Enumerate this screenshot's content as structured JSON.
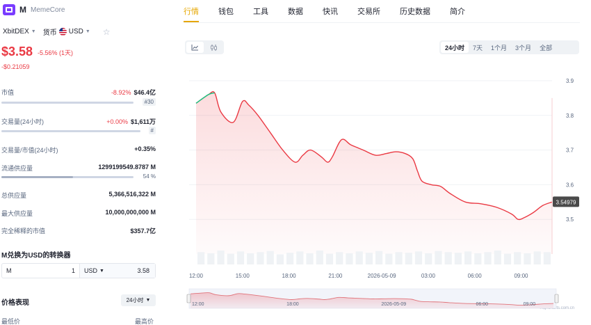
{
  "coin": {
    "symbol": "M",
    "name": "MemeCore"
  },
  "selectors": {
    "exchange": "XbitDEX",
    "currency_label": "货币",
    "currency": "USD"
  },
  "price": {
    "value": "$3.58",
    "change_pct": "-5.56% (1天)",
    "change_abs": "-$0.21059"
  },
  "stats": {
    "market_cap": {
      "label": "市值",
      "change": "-8.92%",
      "value": "$46.4亿",
      "rank": "#30"
    },
    "volume": {
      "label": "交易量(24小时)",
      "change": "+0.00%",
      "value": "$1,611万",
      "rank": "#"
    },
    "vol_mcap": {
      "label": "交易量/市值(24小时)",
      "value": "+0.35%"
    },
    "circ_supply": {
      "label": "流通供应量",
      "value": "1299199549.8787 M",
      "pct": "54 %",
      "fill": 0.54
    },
    "total_supply": {
      "label": "总供应量",
      "value": "5,366,516,322 M"
    },
    "max_supply": {
      "label": "最大供应量",
      "value": "10,000,000,000 M"
    },
    "fdv": {
      "label": "完全稀释的市值",
      "value": "$357.7亿"
    }
  },
  "converter": {
    "title": "M兑换为USD的转换器",
    "from_symbol": "M",
    "from_amount": "1",
    "to_symbol": "USD",
    "to_amount": "3.58"
  },
  "performance": {
    "title": "价格表现",
    "period": "24小时",
    "low_label": "最低价",
    "high_label": "最高价"
  },
  "tabs": [
    "行情",
    "钱包",
    "工具",
    "数据",
    "快讯",
    "交易所",
    "历史数据",
    "简介"
  ],
  "ranges": [
    "24小时",
    "7天",
    "1个月",
    "3个月",
    "全部"
  ],
  "icons": {
    "line_chart": "line-chart-icon",
    "candle_chart": "candlestick-icon",
    "star": "star-icon",
    "caret": "caret-down-icon"
  },
  "colors": {
    "down": "#ea3943",
    "up": "#16c784",
    "accent": "#e6a700"
  },
  "chart_data": {
    "type": "area",
    "x_ticks": [
      "12:00",
      "15:00",
      "18:00",
      "21:00",
      "2026-05-09",
      "03:00",
      "06:00",
      "09:00"
    ],
    "x_tick_hours": [
      0,
      3,
      6,
      9,
      12,
      15,
      18,
      21
    ],
    "y_ticks": [
      "3.9",
      "3.8",
      "3.7",
      "3.6",
      "3.5"
    ],
    "y_tick_values": [
      3.9,
      3.8,
      3.7,
      3.6,
      3.5
    ],
    "ylim": [
      3.4,
      3.9
    ],
    "xlim_hours": [
      0,
      23
    ],
    "current_price_label": "3.54979",
    "current_price": 3.54979,
    "hours": [
      0,
      0.8,
      1.2,
      1.6,
      2.4,
      3.0,
      3.4,
      4.0,
      4.8,
      5.6,
      6.4,
      6.9,
      7.4,
      8.1,
      8.5,
      8.8,
      9.4,
      10.0,
      10.8,
      11.6,
      12.3,
      12.9,
      13.5,
      14.0,
      14.3,
      14.6,
      15.2,
      15.8,
      16.4,
      17.4,
      18.4,
      19.4,
      20.4,
      20.8,
      21.2,
      21.8,
      22.4,
      23.0
    ],
    "prices": [
      3.835,
      3.86,
      3.865,
      3.81,
      3.78,
      3.84,
      3.83,
      3.8,
      3.75,
      3.7,
      3.665,
      3.685,
      3.7,
      3.68,
      3.665,
      3.68,
      3.73,
      3.715,
      3.7,
      3.685,
      3.69,
      3.695,
      3.69,
      3.675,
      3.64,
      3.61,
      3.6,
      3.595,
      3.575,
      3.55,
      3.545,
      3.535,
      3.515,
      3.5,
      3.505,
      3.52,
      3.54,
      3.55
    ],
    "volumes": [
      0.55,
      0.5,
      0.62,
      0.48,
      0.58,
      0.5,
      0.55,
      0.6,
      0.45,
      0.52,
      0.58,
      0.5,
      0.62,
      0.48,
      0.55,
      0.5,
      0.58,
      0.52,
      0.6,
      0.48,
      0.55,
      0.52,
      0.58,
      0.5,
      0.6,
      0.55,
      0.52,
      0.58,
      0.5,
      0.55,
      0.62,
      0.48,
      0.55,
      0.5,
      0.58,
      0.55
    ],
    "navigator_ticks": [
      "12:00",
      "18:00",
      "2026-05-09",
      "06:00",
      "09:00"
    ],
    "navigator_tick_hours": [
      0,
      6,
      12,
      18,
      21
    ],
    "credit": "Highcharts.com.cn"
  }
}
